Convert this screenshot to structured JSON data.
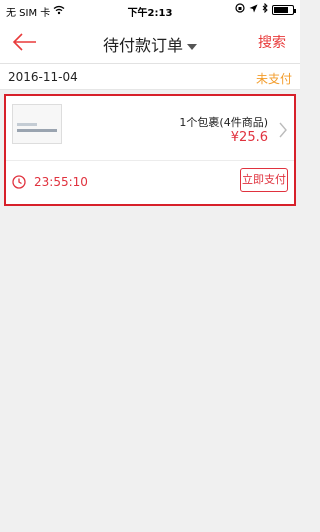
{
  "status_bar": {
    "carrier": "无 SIM 卡",
    "time": "下午2:13"
  },
  "nav": {
    "title": "待付款订单",
    "search_label": "搜索"
  },
  "order": {
    "date": "2016-11-04",
    "status": "未支付",
    "package_info": "1个包裹(4件商品)",
    "price": "¥25.6",
    "countdown": "23:55:10",
    "pay_button": "立即支付"
  },
  "colors": {
    "accent_red": "#e0323e",
    "status_orange": "#f39c2a",
    "highlight_border": "#d7202a"
  },
  "icons": {
    "back": "arrow-left-icon",
    "dropdown": "caret-down-icon",
    "wifi": "wifi-icon",
    "location": "location-arrow-icon",
    "battery": "battery-icon",
    "clock": "clock-icon",
    "chevron": "chevron-right-icon"
  }
}
